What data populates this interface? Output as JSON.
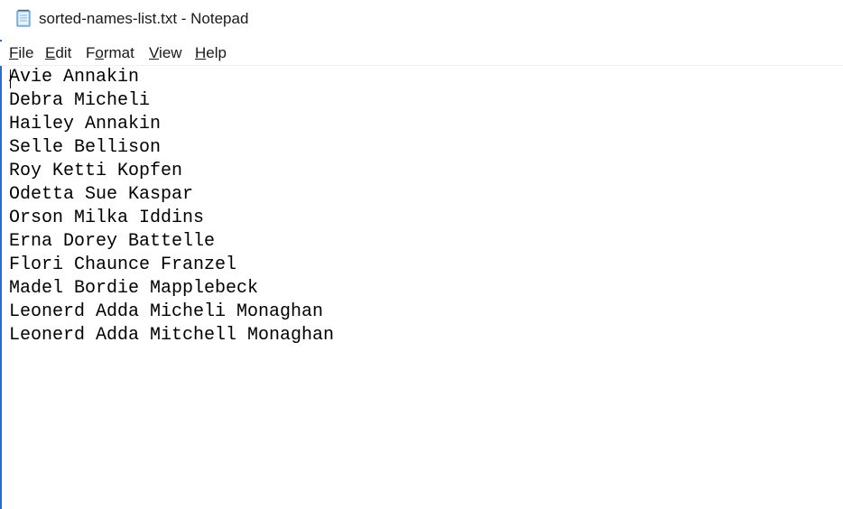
{
  "window": {
    "title": "sorted-names-list.txt - Notepad",
    "icon": "notepad-icon"
  },
  "menu": {
    "items": [
      {
        "mnemonic": "F",
        "rest": "ile"
      },
      {
        "mnemonic": "E",
        "rest": "dit"
      },
      {
        "pre": "F",
        "mnemonic": "o",
        "rest": "rmat"
      },
      {
        "mnemonic": "V",
        "rest": "iew"
      },
      {
        "mnemonic": "H",
        "rest": "elp"
      }
    ]
  },
  "editor": {
    "lines": [
      "Avie Annakin",
      "Debra Micheli",
      "Hailey Annakin",
      "Selle Bellison",
      "Roy Ketti Kopfen",
      "Odetta Sue Kaspar",
      "Orson Milka Iddins",
      "Erna Dorey Battelle",
      "Flori Chaunce Franzel",
      "Madel Bordie Mapplebeck",
      "Leonerd Adda Micheli Monaghan",
      "Leonerd Adda Mitchell Monaghan"
    ]
  },
  "colors": {
    "window_edge": "#2b6cc4",
    "text": "#000000",
    "background": "#ffffff"
  }
}
